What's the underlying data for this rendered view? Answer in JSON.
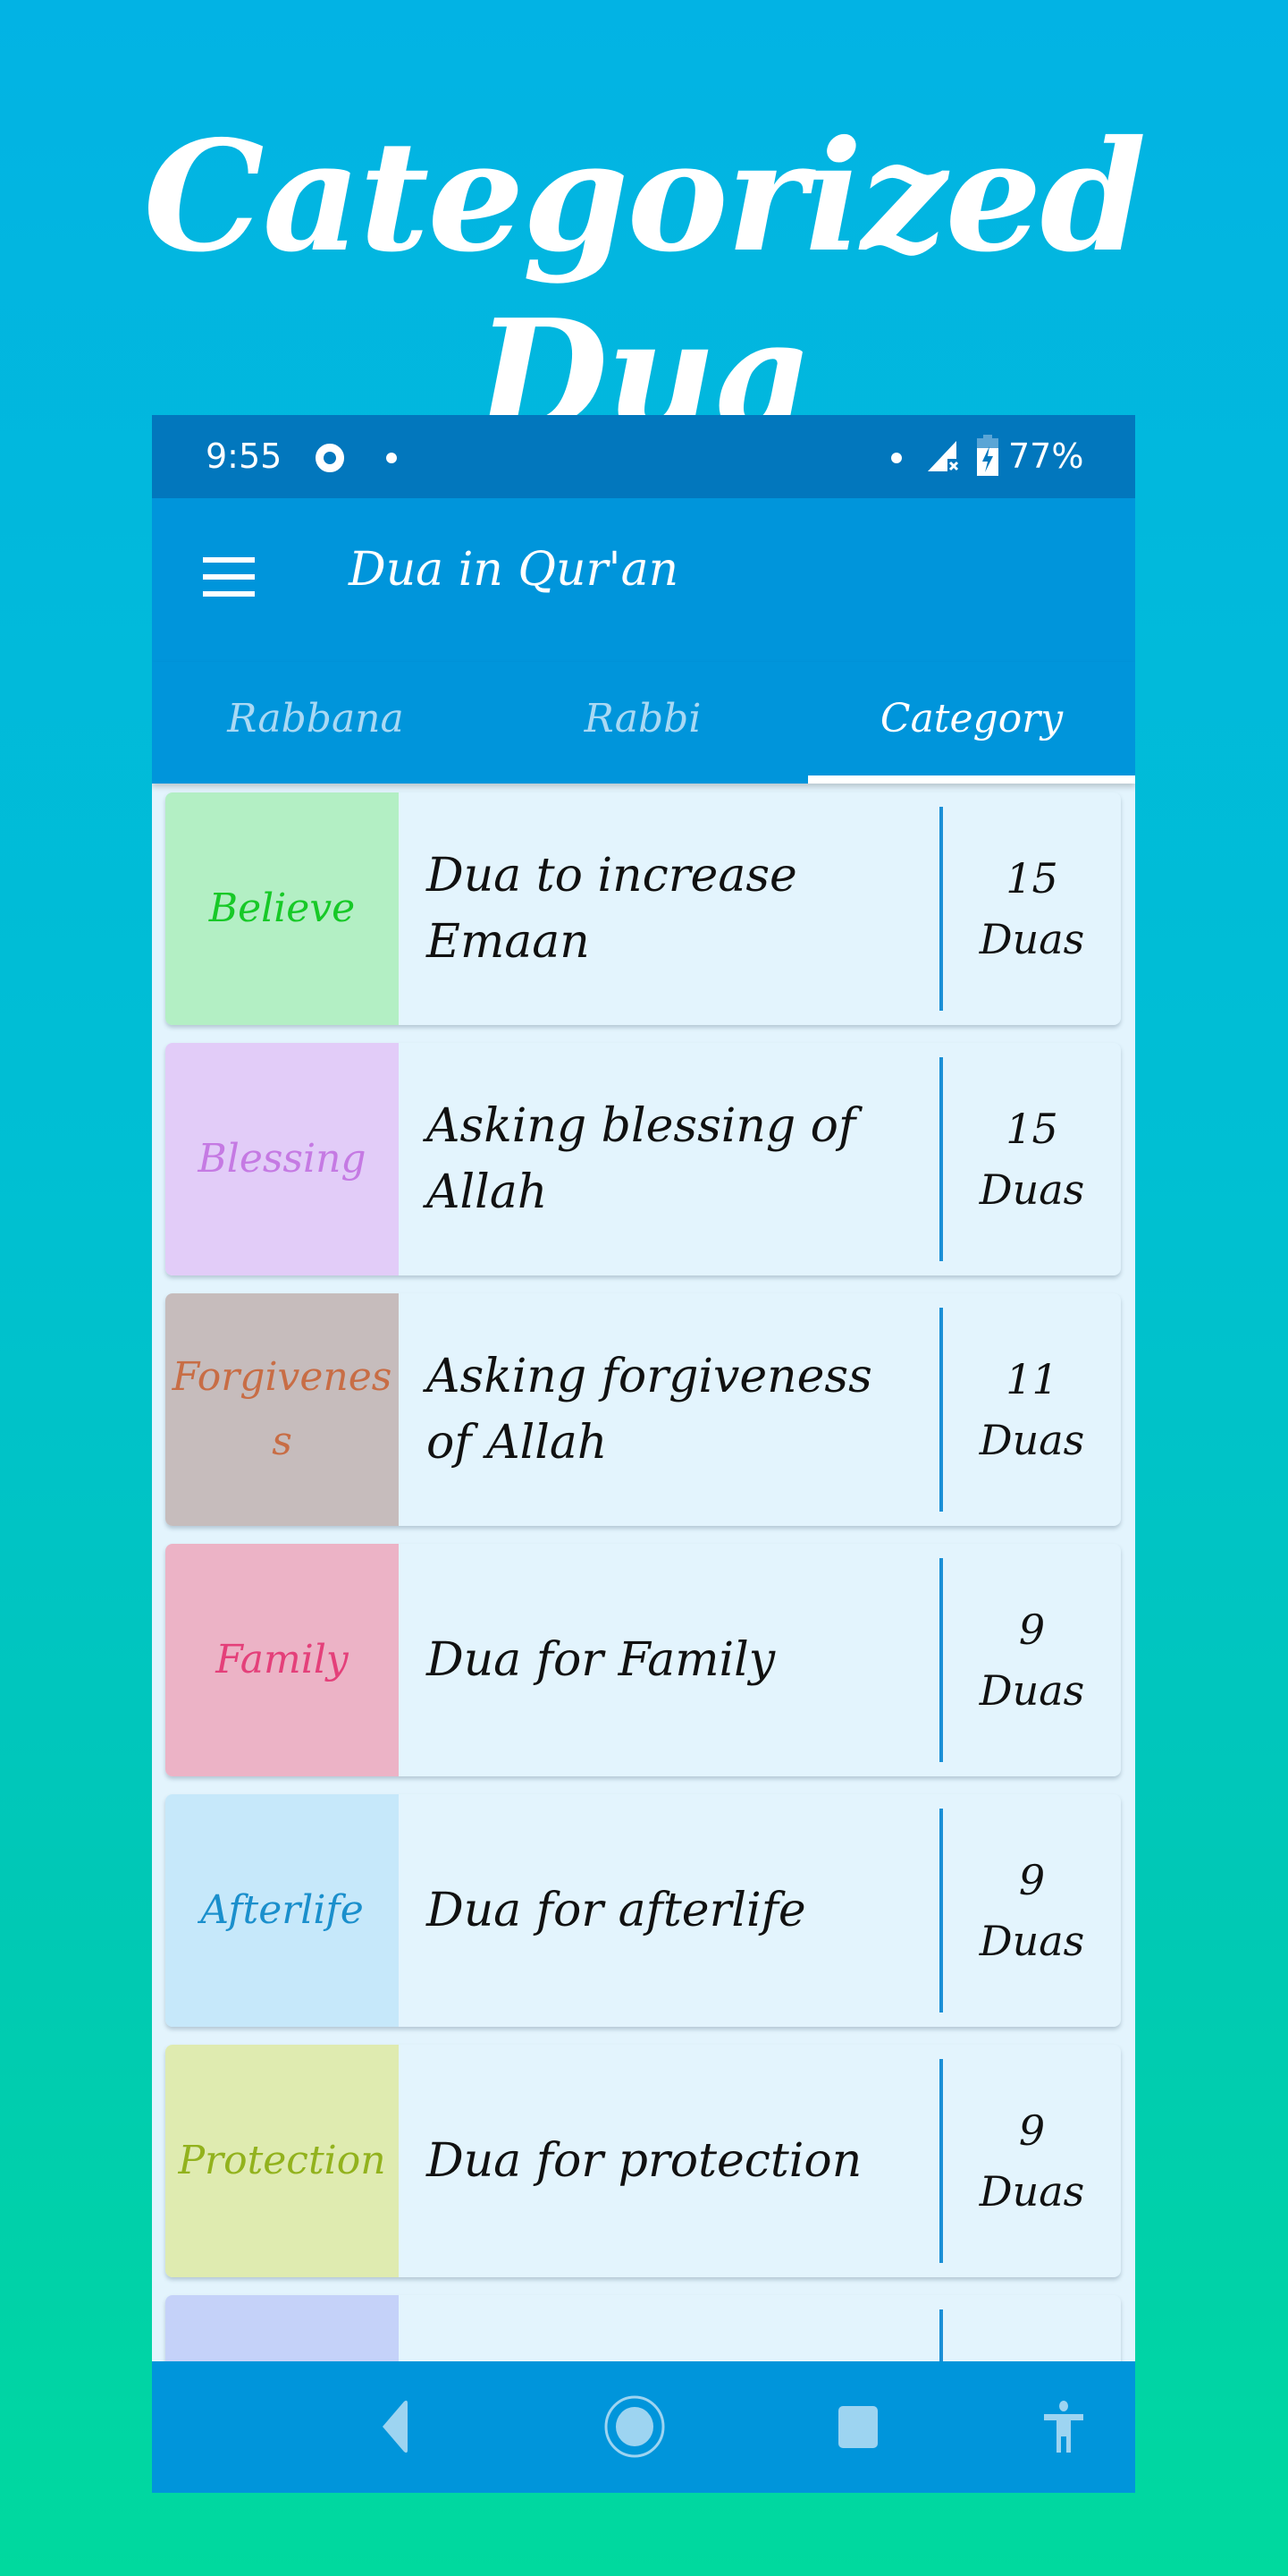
{
  "promo": {
    "title": "Categorized Dua"
  },
  "status_bar": {
    "time": "9:55",
    "battery": "77%"
  },
  "app_bar": {
    "title": "Dua in Qur'an",
    "menu_icon": "hamburger-menu-icon"
  },
  "tabs": [
    {
      "label": "Rabbana",
      "selected": false
    },
    {
      "label": "Rabbi",
      "selected": false
    },
    {
      "label": "Category",
      "selected": true
    }
  ],
  "categories": [
    {
      "tag": "Believe",
      "title": "Dua to increase Emaan",
      "count": "15",
      "unit": "Duas",
      "tag_bg": "#b3efc4",
      "tag_color": "#17c927"
    },
    {
      "tag": "Blessing",
      "title": "Asking blessing of Allah",
      "count": "15",
      "unit": "Duas",
      "tag_bg": "#e2ccf8",
      "tag_color": "#c57ae3"
    },
    {
      "tag": "Forgiveness",
      "title": "Asking forgiveness of Allah",
      "count": "11",
      "unit": "Duas",
      "tag_bg": "#c6bcbc",
      "tag_color": "#c86d45"
    },
    {
      "tag": "Family",
      "title": "Dua for Family",
      "count": "9",
      "unit": "Duas",
      "tag_bg": "#ecb3c6",
      "tag_color": "#e4407a"
    },
    {
      "tag": "Afterlife",
      "title": "Dua for afterlife",
      "count": "9",
      "unit": "Duas",
      "tag_bg": "#c6e8fa",
      "tag_color": "#1a8fcc"
    },
    {
      "tag": "Protection",
      "title": "Dua for protection",
      "count": "9",
      "unit": "Duas",
      "tag_bg": "#dfebb0",
      "tag_color": "#92b21d"
    },
    {
      "tag": "",
      "title": "",
      "count": "",
      "unit": "",
      "tag_bg": "#c5d2f9",
      "tag_color": "#3f5fd1"
    }
  ],
  "nav_bar": {
    "back": "back-icon",
    "home": "home-icon",
    "recents": "recents-icon",
    "accessibility": "accessibility-icon"
  }
}
